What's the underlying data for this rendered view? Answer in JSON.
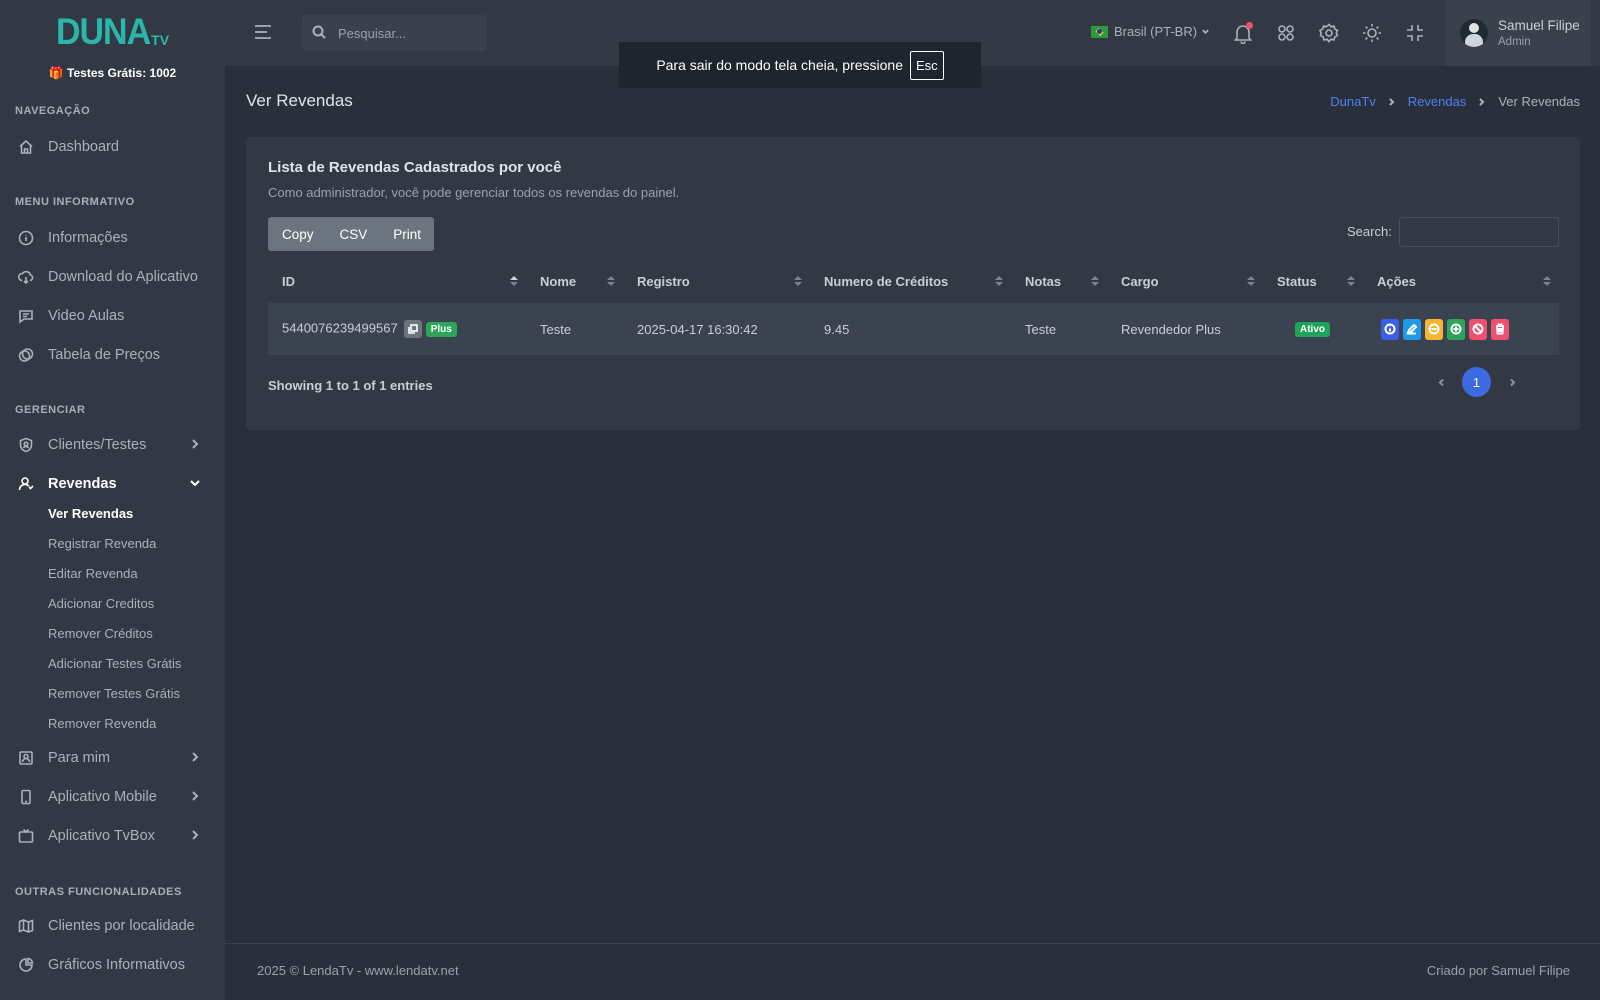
{
  "sidebar": {
    "logo_main": "DUNA",
    "logo_sub": "TV",
    "free_tests": "🎁 Testes Grátis: 1002",
    "sections": {
      "nav": "NAVEGAÇÃO",
      "menu": "MENU INFORMATIVO",
      "manage": "GERENCIAR",
      "other": "OUTRAS FUNCIONALIDADES"
    },
    "items": {
      "dashboard": "Dashboard",
      "info": "Informações",
      "download": "Download do Aplicativo",
      "video": "Video Aulas",
      "prices": "Tabela de Preços",
      "clients": "Clientes/Testes",
      "resellers": "Revendas",
      "forme": "Para mim",
      "mobile": "Aplicativo Mobile",
      "tvbox": "Aplicativo TvBox",
      "location": "Clientes por localidade",
      "charts": "Gráficos Informativos"
    },
    "sub_items": {
      "view": "Ver Revendas",
      "register": "Registrar Revenda",
      "edit": "Editar Revenda",
      "add_credits": "Adicionar Creditos",
      "remove_credits": "Remover Créditos",
      "add_tests": "Adicionar Testes Grátis",
      "remove_tests": "Remover Testes Grátis",
      "remove": "Remover Revenda"
    }
  },
  "topbar": {
    "search_placeholder": "Pesquisar...",
    "language": "Brasil (PT-BR)",
    "user_name": "Samuel Filipe",
    "user_role": "Admin"
  },
  "toast": {
    "text": "Para sair do modo tela cheia, pressione",
    "key": "Esc"
  },
  "page": {
    "title": "Ver Revendas",
    "breadcrumb": [
      "DunaTv",
      "Revendas",
      "Ver Revendas"
    ]
  },
  "card": {
    "title": "Lista de Revendas Cadastrados por você",
    "subtitle": "Como administrador, você pode gerenciar todos os revendas do painel.",
    "buttons": {
      "copy": "Copy",
      "csv": "CSV",
      "print": "Print"
    },
    "search_label": "Search:",
    "columns": [
      "ID",
      "Nome",
      "Registro",
      "Numero de Créditos",
      "Notas",
      "Cargo",
      "Status",
      "Ações"
    ],
    "rows": [
      {
        "id": "5440076239499567",
        "tag": "Plus",
        "nome": "Teste",
        "registro": "2025-04-17 16:30:42",
        "creditos": "9.45",
        "notas": "Teste",
        "cargo": "Revendedor Plus",
        "status": "Ativo"
      }
    ],
    "action_colors": [
      "#3b5ee6",
      "#1e9be6",
      "#f5b531",
      "#2ca55a",
      "#f0506e",
      "#f0506e"
    ],
    "showing": "Showing 1 to 1 of 1 entries",
    "page_number": "1"
  },
  "footer": {
    "left": "2025 © LendaTv - www.lendatv.net",
    "right": "Criado por Samuel Filipe"
  }
}
